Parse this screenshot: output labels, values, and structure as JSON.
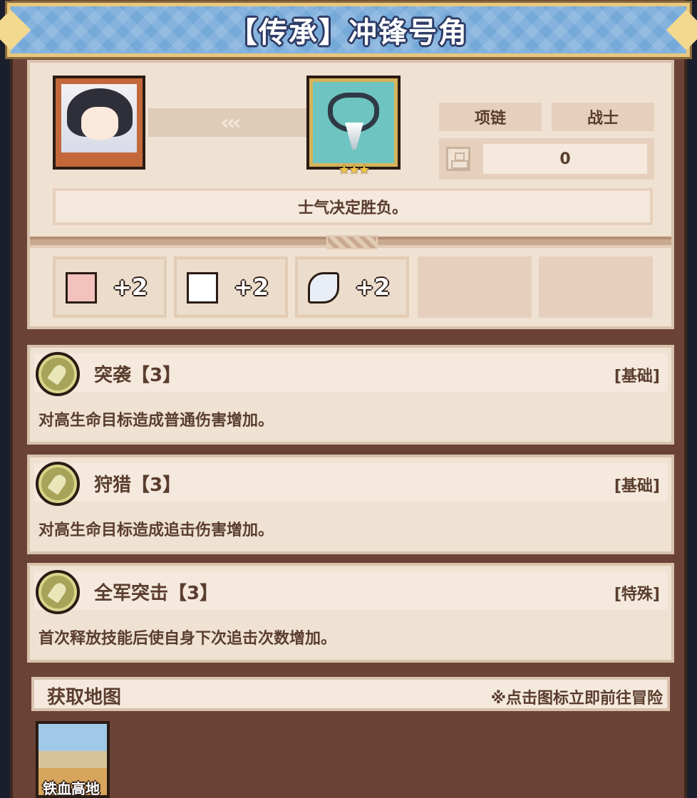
{
  "title": "【传承】冲锋号角",
  "item": {
    "arrows": "‹‹‹",
    "stars": "★★★",
    "type_tag": "项链",
    "class_tag": "战士",
    "power_value": "0",
    "motto": "士气决定胜负。"
  },
  "stats": [
    {
      "icon": "fist-icon",
      "value": "+2"
    },
    {
      "icon": "book-icon",
      "value": "+2"
    },
    {
      "icon": "feather-icon",
      "value": "+2"
    }
  ],
  "skills": [
    {
      "name": "突袭",
      "level": "【3】",
      "kind": "[基础]",
      "desc": "对高生命目标造成普通伤害增加。"
    },
    {
      "name": "狩猎",
      "level": "【3】",
      "kind": "[基础]",
      "desc": "对高生命目标造成追击伤害增加。"
    },
    {
      "name": "全军突击",
      "level": "【3】",
      "kind": "[特殊]",
      "desc": "首次释放技能后使自身下次追击次数增加。"
    }
  ],
  "acquire": {
    "title": "获取地图",
    "hint": "※点击图标立即前往冒险",
    "maps": [
      {
        "name": "铁血高地"
      }
    ]
  },
  "colors": {
    "banner": "#74a9d8",
    "panel": "#efe2d2",
    "frame": "#6b4336",
    "text": "#5a3d2e"
  }
}
